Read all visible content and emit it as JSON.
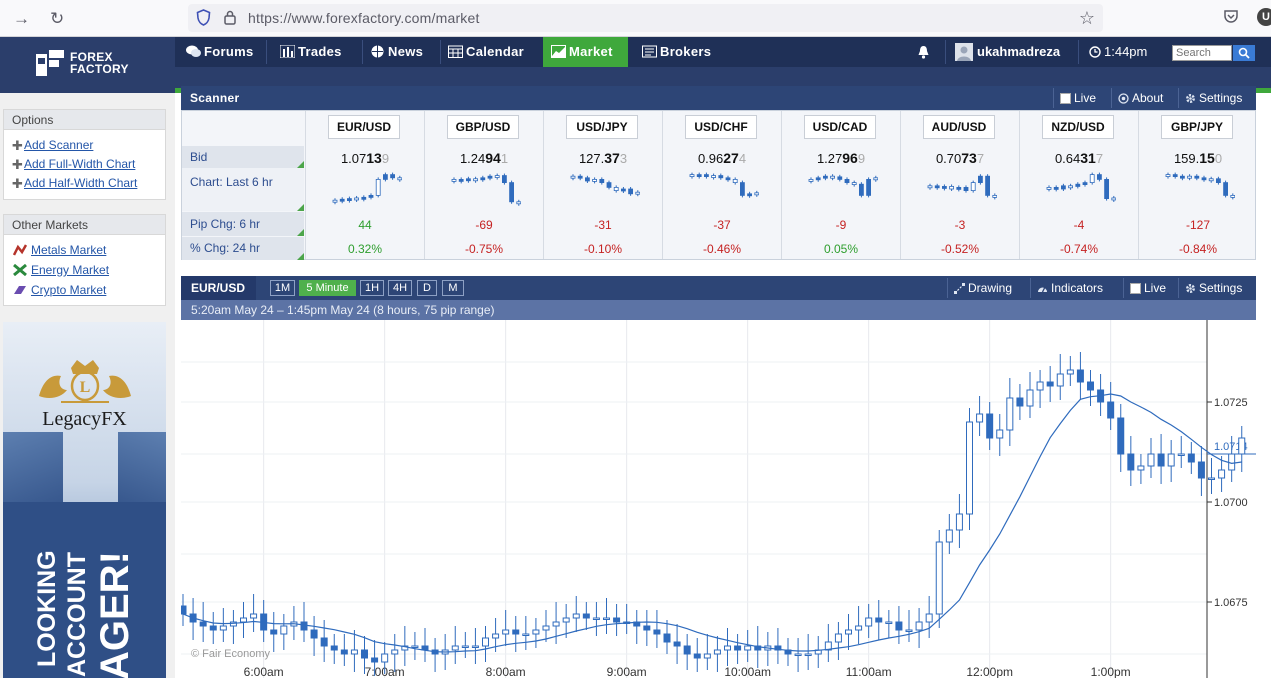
{
  "browser": {
    "url": "https://www.forexfactory.com/market"
  },
  "brand": {
    "line1": "FOREX",
    "line2": "FACTORY"
  },
  "nav": {
    "tabs": [
      {
        "label": "Forums",
        "icon": "chat-icon"
      },
      {
        "label": "Trades",
        "icon": "bars-icon"
      },
      {
        "label": "News",
        "icon": "globe-icon"
      },
      {
        "label": "Calendar",
        "icon": "calendar-icon"
      },
      {
        "label": "Market",
        "icon": "chart-icon",
        "active": true
      },
      {
        "label": "Brokers",
        "icon": "brokers-icon"
      }
    ],
    "username": "ukahmadreza",
    "time": "1:44pm",
    "search_placeholder": "Search"
  },
  "sidebar": {
    "options_title": "Options",
    "options": [
      "Add Scanner",
      "Add Full-Width Chart",
      "Add Half-Width Chart"
    ],
    "markets_title": "Other Markets",
    "markets": [
      "Metals Market",
      "Energy Market",
      "Crypto Market"
    ],
    "ad": {
      "brand": "LegacyFX",
      "lines": [
        "LOOKING",
        "ACCOUNT",
        "AGER!"
      ]
    }
  },
  "scanner": {
    "title": "Scanner",
    "buttons": [
      "Live",
      "About",
      "Settings"
    ],
    "row_labels": [
      "Bid",
      "Chart: Last 6 hr",
      "Pip Chg: 6 hr",
      "% Chg: 24 hr"
    ],
    "pairs": [
      {
        "pair": "EUR/USD",
        "bid_a": "1.07",
        "bid_b": "13",
        "bid_c": "9",
        "pip": "44",
        "pct": "0.32%",
        "dir": "pos"
      },
      {
        "pair": "GBP/USD",
        "bid_a": "1.24",
        "bid_b": "94",
        "bid_c": "1",
        "pip": "-69",
        "pct": "-0.75%",
        "dir": "neg"
      },
      {
        "pair": "USD/JPY",
        "bid_a": "127.",
        "bid_b": "37",
        "bid_c": "3",
        "pip": "-31",
        "pct": "-0.10%",
        "dir": "neg"
      },
      {
        "pair": "USD/CHF",
        "bid_a": "0.96",
        "bid_b": "27",
        "bid_c": "4",
        "pip": "-37",
        "pct": "-0.46%",
        "dir": "neg"
      },
      {
        "pair": "USD/CAD",
        "bid_a": "1.27",
        "bid_b": "96",
        "bid_c": "9",
        "pip": "-9",
        "pct": "0.05%",
        "dir": "mix"
      },
      {
        "pair": "AUD/USD",
        "bid_a": "0.70",
        "bid_b": "73",
        "bid_c": "7",
        "pip": "-3",
        "pct": "-0.52%",
        "dir": "neg"
      },
      {
        "pair": "NZD/USD",
        "bid_a": "0.64",
        "bid_b": "31",
        "bid_c": "7",
        "pip": "-4",
        "pct": "-0.74%",
        "dir": "neg"
      },
      {
        "pair": "GBP/JPY",
        "bid_a": "159.",
        "bid_b": "15",
        "bid_c": "0",
        "pip": "-127",
        "pct": "-0.84%",
        "dir": "neg"
      }
    ]
  },
  "chart": {
    "pair": "EUR/USD",
    "timeframes": [
      "1M",
      "5 Minute",
      "1H",
      "4H",
      "D",
      "M"
    ],
    "active_timeframe": "5 Minute",
    "buttons": [
      "Drawing",
      "Indicators",
      "Live",
      "Settings"
    ],
    "subtitle": "5:20am May 24 – 1:45pm May 24 (8 hours, 75 pip range)",
    "copyright": "© Fair Economy",
    "y_ticks": [
      "1.0725",
      "1.0700",
      "1.0675"
    ],
    "current_price": "1.0714",
    "x_ticks": [
      "6:00am",
      "7:00am",
      "8:00am",
      "9:00am",
      "10:00am",
      "11:00am",
      "12:00pm",
      "1:00pm"
    ]
  },
  "chart_data": {
    "type": "candlestick",
    "title": "EUR/USD",
    "ylim": [
      1.065,
      1.0745
    ],
    "start": "5:20am",
    "interval_minutes": 5,
    "close": [
      1.0672,
      1.067,
      1.0669,
      1.0668,
      1.0669,
      1.067,
      1.0671,
      1.0672,
      1.0668,
      1.0667,
      1.0669,
      1.067,
      1.0668,
      1.0666,
      1.0664,
      1.0663,
      1.0662,
      1.0663,
      1.0661,
      1.066,
      1.0662,
      1.0663,
      1.0664,
      1.0664,
      1.0663,
      1.0662,
      1.0663,
      1.0664,
      1.0664,
      1.0664,
      1.0666,
      1.0667,
      1.0668,
      1.0667,
      1.0667,
      1.0668,
      1.0669,
      1.067,
      1.0671,
      1.0672,
      1.0671,
      1.0671,
      1.0671,
      1.067,
      1.067,
      1.0669,
      1.0668,
      1.0667,
      1.0665,
      1.0664,
      1.0662,
      1.0661,
      1.0662,
      1.0663,
      1.0664,
      1.0663,
      1.0664,
      1.0663,
      1.0664,
      1.0663,
      1.0662,
      1.0662,
      1.0662,
      1.0663,
      1.0665,
      1.0667,
      1.0668,
      1.0669,
      1.0671,
      1.067,
      1.067,
      1.0668,
      1.0668,
      1.067,
      1.0672,
      1.069,
      1.0693,
      1.0697,
      1.072,
      1.0722,
      1.0716,
      1.0718,
      1.0726,
      1.0724,
      1.0728,
      1.073,
      1.0729,
      1.0732,
      1.0733,
      1.073,
      1.0728,
      1.0725,
      1.0721,
      1.0712,
      1.0708,
      1.0709,
      1.0712,
      1.0709,
      1.0712,
      1.0712,
      1.071,
      1.0706,
      1.0706,
      1.0708,
      1.0712,
      1.0716
    ]
  }
}
